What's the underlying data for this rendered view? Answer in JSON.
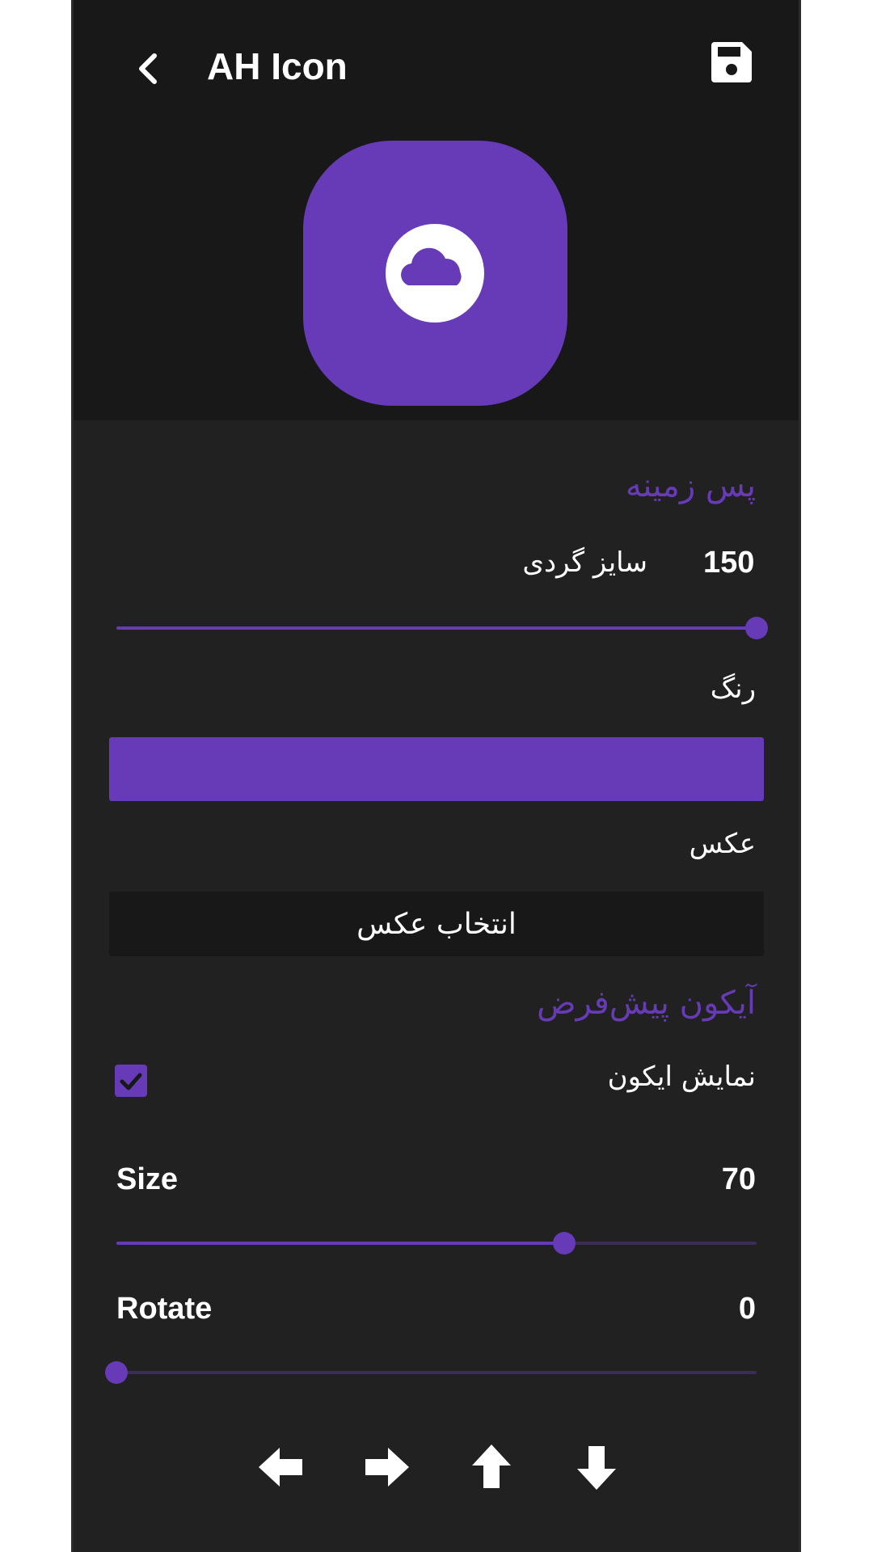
{
  "app": {
    "title": "AH Icon",
    "accent_color": "#673ab7",
    "background_color": "#212121",
    "header_background_color": "#181818"
  },
  "header": {
    "back_icon": "chevron-left-icon",
    "save_icon": "floppy-disk-icon"
  },
  "preview": {
    "icon_background_color": "#673ab7",
    "glyph_icon": "cloud-icon"
  },
  "background_section": {
    "title": "پس زمینه",
    "corner_radius_label": "سایز گردی",
    "corner_radius_value": "150",
    "corner_radius_fraction": 1.0,
    "color_label": "رنگ",
    "color_value": "#673ab7",
    "image_label": "عکس",
    "pick_image_button": "انتخاب عکس"
  },
  "default_icon_section": {
    "title": "آیکون پیش‌فرض",
    "show_icon_label": "نمایش ایکون",
    "show_icon_checked": true,
    "size_label": "Size",
    "size_value": "70",
    "size_fraction": 0.7,
    "rotate_label": "Rotate",
    "rotate_value": "0",
    "rotate_fraction": 0.0
  },
  "move_controls": {
    "left_icon": "arrow-left-icon",
    "right_icon": "arrow-right-icon",
    "up_icon": "arrow-up-icon",
    "down_icon": "arrow-down-icon"
  }
}
